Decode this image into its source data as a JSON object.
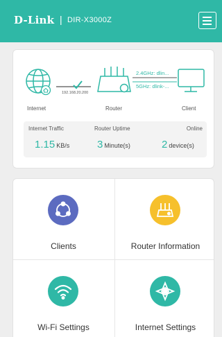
{
  "header": {
    "brand": "D-Link",
    "separator": "|",
    "model": "DIR-X3000Z",
    "menu_icon": "hamburger-menu-icon"
  },
  "status": {
    "ip_address": "192.168.20.200",
    "wifi_24": "2.4GHz: dlin...",
    "wifi_5": "5GHz: dlink-...",
    "labels": {
      "internet": "Internet",
      "router": "Router",
      "client": "Client"
    },
    "traffic_label": "Internet Traffic",
    "traffic_value": "1.15",
    "traffic_unit": "KB/s",
    "uptime_label": "Router Uptime",
    "uptime_value": "3",
    "uptime_unit": "Minute(s)",
    "online_label": "Online",
    "online_value": "2",
    "online_unit": "device(s)",
    "icons": [
      "globe-icon",
      "router-icon",
      "monitor-icon",
      "checkmark-icon"
    ]
  },
  "tiles": [
    {
      "label": "Clients",
      "icon": "clients-icon",
      "color": "#5c6bc0"
    },
    {
      "label": "Router Information",
      "icon": "router-info-icon",
      "color": "#f6c02c"
    },
    {
      "label": "Wi-Fi Settings",
      "icon": "wifi-icon",
      "color": "#2fb8a6"
    },
    {
      "label": "Internet Settings",
      "icon": "internet-settings-icon",
      "color": "#2fb8a6"
    }
  ],
  "colors": {
    "accent": "#2fb8a6",
    "clients": "#5c6bc0",
    "router_info": "#f6c02c"
  }
}
